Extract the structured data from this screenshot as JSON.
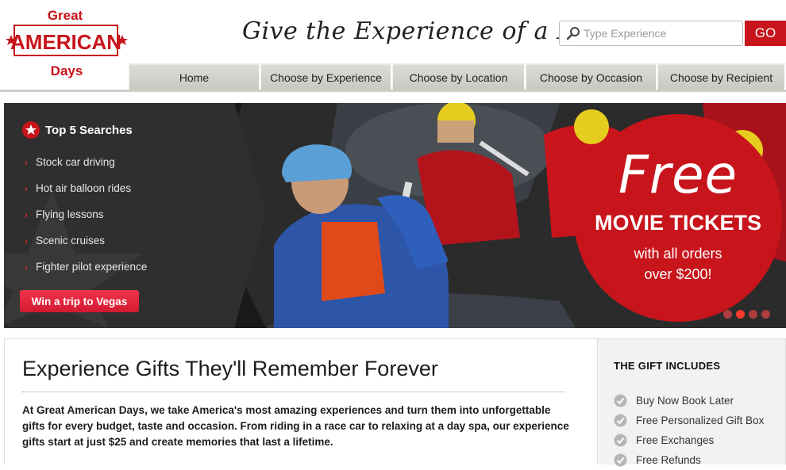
{
  "header": {
    "logo": {
      "line1": "Great",
      "line2": "AMERICAN",
      "line3": "Days"
    },
    "tagline": "Give the Experience of a Lifetime",
    "search_placeholder": "Type Experience",
    "go_label": "GO"
  },
  "nav": {
    "items": [
      "Home",
      "Choose by Experience",
      "Choose by Location",
      "Choose by Occasion",
      "Choose by Recipient"
    ]
  },
  "banner": {
    "top5_title": "Top 5 Searches",
    "searches": [
      "Stock car driving",
      "Hot air balloon rides",
      "Flying lessons",
      "Scenic cruises",
      "Fighter pilot experience"
    ],
    "cta_label": "Win a trip to Vegas",
    "promo": {
      "free": "Free",
      "movie": "MOVIE TICKETS",
      "line1": "with all orders",
      "line2": "over $200!"
    },
    "slides": 4,
    "active_slide": 2
  },
  "main": {
    "title": "Experience Gifts They'll Remember Forever",
    "intro": "At Great American Days, we take America's most amazing experiences and turn them into unforgettable gifts for every budget, taste and occasion. From riding in a race car to relaxing at a day spa, our experience gifts start at just $25 and create memories that last a lifetime."
  },
  "sidebar": {
    "title": "THE GIFT INCLUDES",
    "items": [
      "Buy Now Book Later",
      "Free Personalized Gift Box",
      "Free Exchanges",
      "Free Refunds"
    ]
  },
  "colors": {
    "brand_red": "#c8141b",
    "nav_bg": "#d2d2cb",
    "banner_dark": "#202020"
  }
}
